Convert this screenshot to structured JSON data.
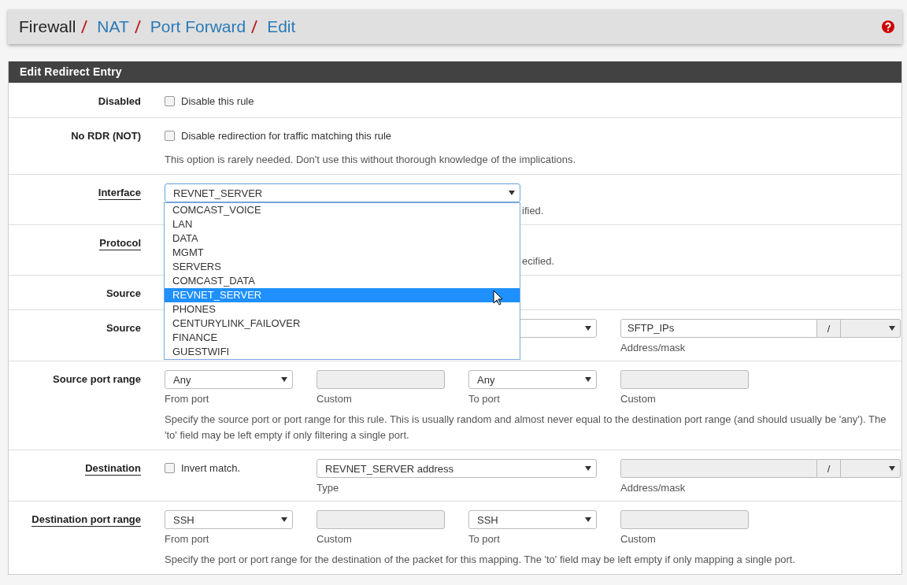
{
  "breadcrumb": [
    {
      "text": "Firewall",
      "link": false
    },
    {
      "text": "NAT",
      "link": true
    },
    {
      "text": "Port Forward",
      "link": true
    },
    {
      "text": "Edit",
      "link": true
    }
  ],
  "panel": {
    "title": "Edit Redirect Entry",
    "rows": [
      {
        "label": "Disabled",
        "help_link": false,
        "cells": [
          {
            "kind": "checkbox",
            "label": "Disable this rule",
            "checked": false
          }
        ]
      },
      {
        "label": "No RDR (NOT)",
        "help_link": false,
        "cells": [
          {
            "kind": "checkbox",
            "label": "Disable redirection for traffic matching this rule",
            "checked": false
          }
        ],
        "hint": "This option is rarely needed. Don't use this without thorough knowledge of the implications."
      },
      {
        "label": "Interface",
        "help_link": true,
        "cells": [
          {
            "kind": "wide-select",
            "value": "REVNET_SERVER",
            "open": true
          }
        ],
        "hint_tail": "ified."
      },
      {
        "label": "Protocol",
        "help_link": true,
        "cells": [
          {
            "kind": "covered"
          }
        ],
        "hint_tail": "ecified."
      },
      {
        "label": "Source",
        "help_link": false,
        "cells": [
          {
            "kind": "covered"
          }
        ]
      },
      {
        "label": "Source",
        "help_link": false,
        "cells": [
          "",
          {
            "kind": "type-select"
          },
          "",
          {
            "kind": "address",
            "value": "SFTP_IPs",
            "separator": "/",
            "disabled": false,
            "sublabel": "Address/mask"
          }
        ]
      },
      {
        "label": "Source port range",
        "help_link": false,
        "cells": [
          {
            "kind": "select",
            "value": "Any",
            "sublabel": "From port"
          },
          {
            "kind": "input",
            "disabled": true,
            "sublabel": "Custom"
          },
          {
            "kind": "select",
            "value": "Any",
            "sublabel": "To port"
          },
          {
            "kind": "input",
            "disabled": true,
            "sublabel": "Custom"
          }
        ],
        "hint": "Specify the source port or port range for this rule. This is usually random and almost never equal to the destination port range (and should usually be 'any'). The 'to' field may be left empty if only filtering a single port."
      },
      {
        "label": "Destination",
        "help_link": true,
        "cells": [
          {
            "kind": "checkbox",
            "label": "Invert match.",
            "checked": false
          },
          {
            "kind": "type-select",
            "value": "REVNET_SERVER address",
            "sublabel": "Type"
          },
          "",
          {
            "kind": "address",
            "separator": "/",
            "disabled": true,
            "sublabel": "Address/mask"
          }
        ]
      },
      {
        "label": "Destination port range",
        "help_link": true,
        "cells": [
          {
            "kind": "select",
            "value": "SSH",
            "sublabel": "From port"
          },
          {
            "kind": "input",
            "disabled": true,
            "sublabel": "Custom"
          },
          {
            "kind": "select",
            "value": "SSH",
            "sublabel": "To port"
          },
          {
            "kind": "input",
            "disabled": true,
            "sublabel": "Custom"
          }
        ],
        "hint": "Specify the port or port range for the destination of the packet for this mapping. The 'to' field may be left empty if only mapping a single port."
      }
    ]
  },
  "interface_dropdown": {
    "options": [
      {
        "label": "COMCAST_VOICE",
        "selected": false
      },
      {
        "label": "LAN",
        "selected": false
      },
      {
        "label": "DATA",
        "selected": false
      },
      {
        "label": "MGMT",
        "selected": false
      },
      {
        "label": "SERVERS",
        "selected": false
      },
      {
        "label": "COMCAST_DATA",
        "selected": false
      },
      {
        "label": "REVNET_SERVER",
        "selected": true
      },
      {
        "label": "PHONES",
        "selected": false
      },
      {
        "label": "CENTURYLINK_FAILOVER",
        "selected": false
      },
      {
        "label": "FINANCE",
        "selected": false
      },
      {
        "label": "GUESTWIFI",
        "selected": false
      }
    ]
  }
}
